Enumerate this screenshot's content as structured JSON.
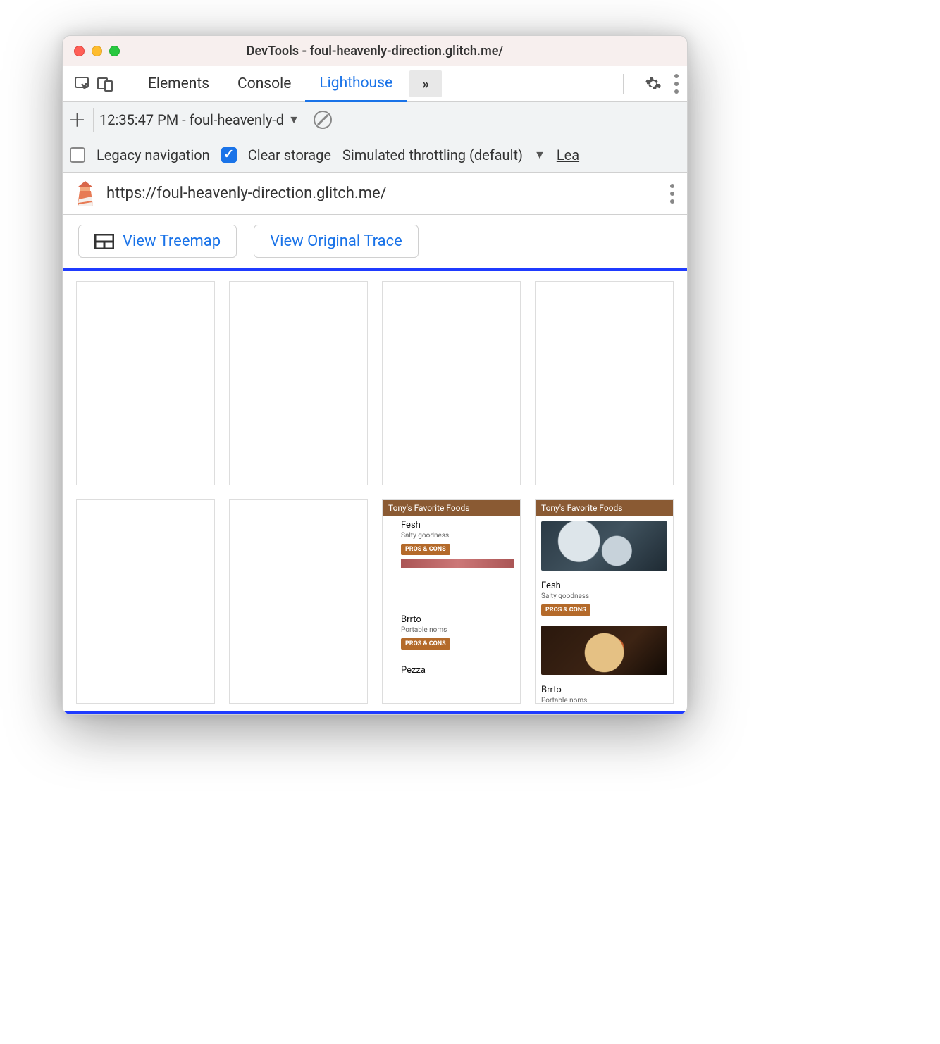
{
  "titlebar": {
    "title": "DevTools - foul-heavenly-direction.glitch.me/"
  },
  "tabbar": {
    "tabs": {
      "elements": "Elements",
      "console": "Console",
      "lighthouse": "Lighthouse"
    },
    "more_glyph": "»"
  },
  "subbar": {
    "run_label": "12:35:47 PM - foul-heavenly-d"
  },
  "options": {
    "legacy_label": "Legacy navigation",
    "legacy_checked": false,
    "clear_label": "Clear storage",
    "clear_checked": true,
    "throttle_label": "Simulated throttling (default)",
    "more_label": "Lea"
  },
  "urlbar": {
    "url": "https://foul-heavenly-direction.glitch.me/"
  },
  "buttons": {
    "treemap": "View Treemap",
    "trace": "View Original Trace"
  },
  "filmstrip": {
    "header": "Tony's Favorite Foods",
    "items": [
      {
        "title": "Fesh",
        "sub": "Salty goodness",
        "btn": "PROS & CONS"
      },
      {
        "title": "Brrto",
        "sub": "Portable noms",
        "btn": "PROS & CONS"
      },
      {
        "title": "Pezza",
        "sub": "",
        "btn": ""
      }
    ]
  }
}
